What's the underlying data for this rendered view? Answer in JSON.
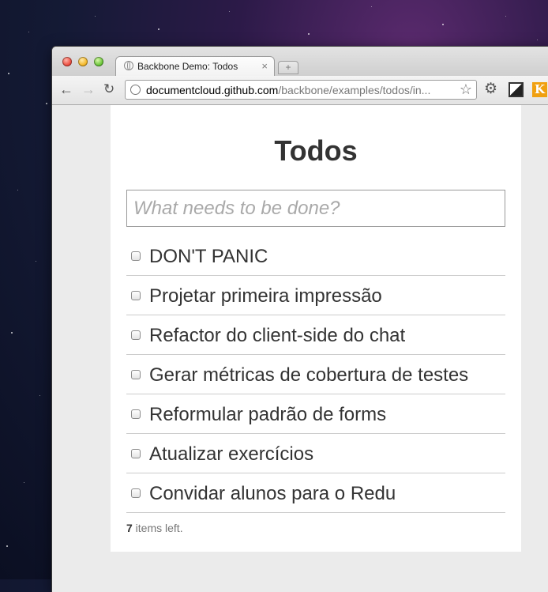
{
  "browser": {
    "tab_title": "Backbone Demo: Todos",
    "tab_close": "×",
    "new_tab": "+",
    "url_host": "documentcloud.github.com",
    "url_path": "/backbone/examples/todos/in...",
    "ext_k": "K"
  },
  "app": {
    "title": "Todos",
    "new_todo_placeholder": "What needs to be done?",
    "todos": [
      {
        "text": "DON'T PANIC",
        "done": false
      },
      {
        "text": "Projetar primeira impressão",
        "done": false
      },
      {
        "text": "Refactor do client-side do chat",
        "done": false
      },
      {
        "text": "Gerar métricas de cobertura de testes",
        "done": false
      },
      {
        "text": "Reformular padrão de forms",
        "done": false
      },
      {
        "text": "Atualizar exercícios",
        "done": false
      },
      {
        "text": "Convidar alunos para o Redu",
        "done": false
      }
    ],
    "footer": {
      "count": "7",
      "label": " items left."
    }
  }
}
